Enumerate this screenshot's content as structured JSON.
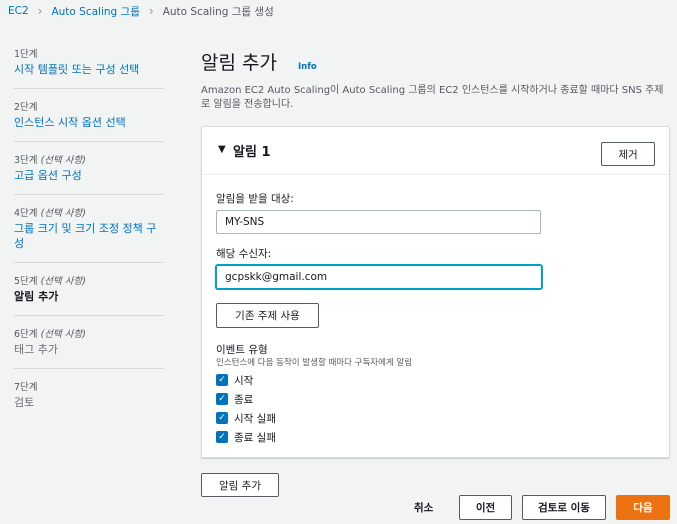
{
  "breadcrumb": {
    "items": [
      "EC2",
      "Auto Scaling 그룹",
      "Auto Scaling 그룹 생성"
    ]
  },
  "steps": [
    {
      "num": "1단계",
      "optional": "",
      "title": "시작 템플릿 또는 구성 선택"
    },
    {
      "num": "2단계",
      "optional": "",
      "title": "인스턴스 시작 옵션 선택"
    },
    {
      "num": "3단계",
      "optional": "(선택 사항)",
      "title": "고급 옵션 구성"
    },
    {
      "num": "4단계",
      "optional": "(선택 사항)",
      "title": "그룹 크기 및 크기 조정 정책 구성"
    },
    {
      "num": "5단계",
      "optional": "(선택 사항)",
      "title": "알림 추가"
    },
    {
      "num": "6단계",
      "optional": "(선택 사항)",
      "title": "태그 추가"
    },
    {
      "num": "7단계",
      "optional": "",
      "title": "검토"
    }
  ],
  "main": {
    "title": "알림 추가",
    "info": "Info",
    "description": "Amazon EC2 Auto Scaling이 Auto Scaling 그룹의 EC2 인스턴스를 시작하거나 종료할 때마다 SNS 주제로 알림을 전송합니다."
  },
  "notification": {
    "title": "알림 1",
    "remove_label": "제거",
    "target_label": "알림을 받을 대상:",
    "target_value": "MY-SNS",
    "recipients_label": "해당 수신자:",
    "recipients_value": "gcpskk@gmail.com",
    "use_existing_label": "기존 주제 사용",
    "event_type_label": "이벤트 유형",
    "event_type_desc": "인스턴스에 다음 동작이 발생할 때마다 구독자에게 알림",
    "events": [
      {
        "label": "시작",
        "checked": true
      },
      {
        "label": "종료",
        "checked": true
      },
      {
        "label": "시작 실패",
        "checked": true
      },
      {
        "label": "종료 실패",
        "checked": true
      }
    ]
  },
  "add_notification_label": "알림 추가",
  "footer": {
    "cancel": "취소",
    "previous": "이전",
    "review": "검토로 이동",
    "next": "다음"
  },
  "colors": {
    "link": "#0073bb",
    "primary": "#ec7211",
    "background": "#f2f3f3",
    "focus": "#00a1c9"
  }
}
